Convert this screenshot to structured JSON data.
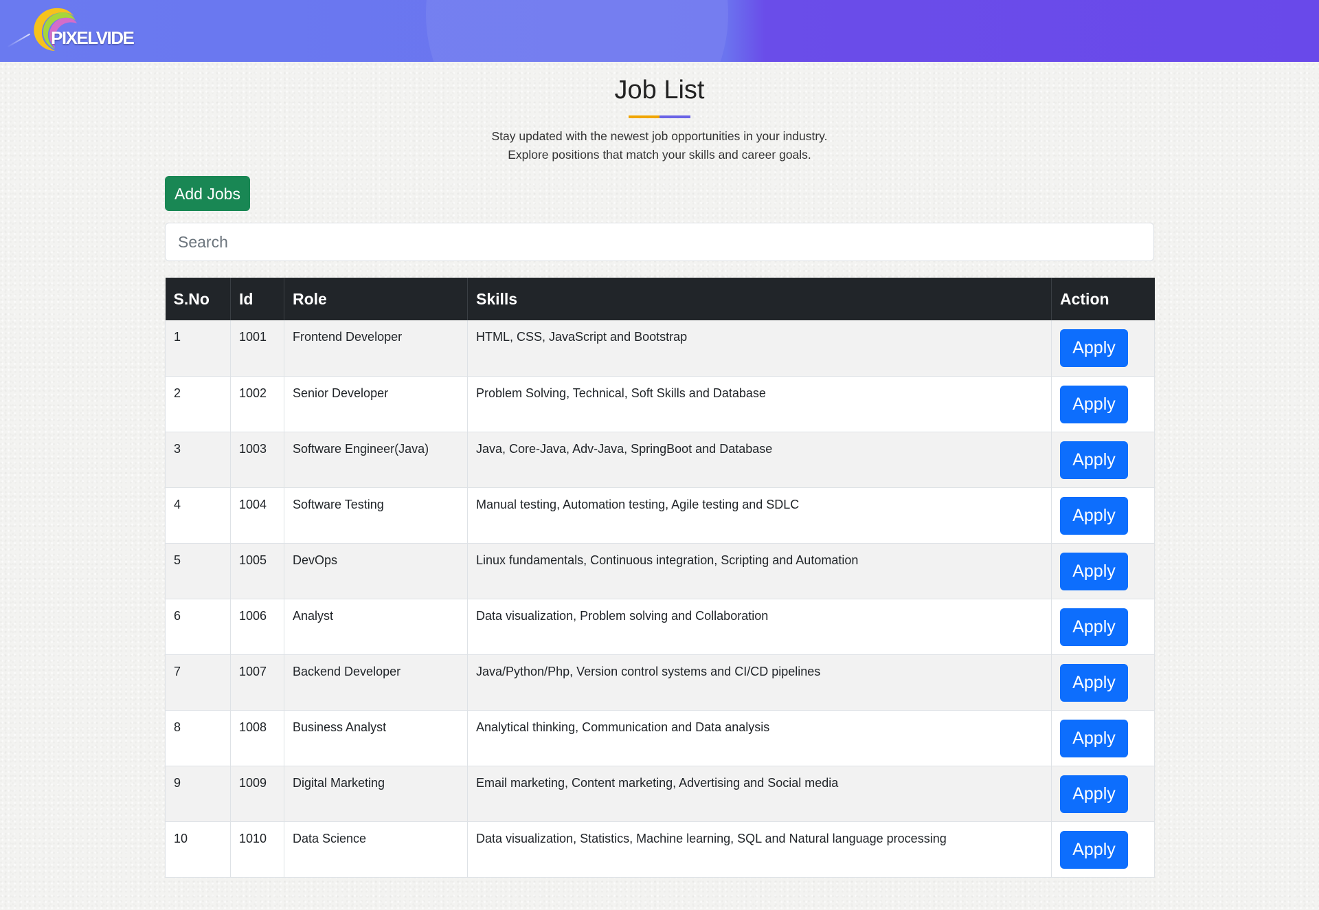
{
  "header": {
    "logo_text": "PIXELVIDE",
    "colors": {
      "gradient_left": "#6a7af0",
      "gradient_right": "#6949ea"
    }
  },
  "page": {
    "title": "Job List",
    "subtitle_line1": "Stay updated with the newest job opportunities in your industry.",
    "subtitle_line2": "Explore positions that match your skills and career goals."
  },
  "toolbar": {
    "add_jobs_label": "Add Jobs",
    "add_jobs_color": "#198754"
  },
  "search": {
    "placeholder": "Search",
    "value": ""
  },
  "table": {
    "headers": [
      "S.No",
      "Id",
      "Role",
      "Skills",
      "Action"
    ],
    "apply_label": "Apply",
    "apply_color": "#0d6efd",
    "rows": [
      {
        "sno": "1",
        "id": "1001",
        "role": "Frontend Developer",
        "skills": "HTML, CSS, JavaScript and Bootstrap"
      },
      {
        "sno": "2",
        "id": "1002",
        "role": "Senior Developer",
        "skills": "Problem Solving, Technical, Soft Skills and Database"
      },
      {
        "sno": "3",
        "id": "1003",
        "role": "Software Engineer(Java)",
        "skills": "Java, Core-Java, Adv-Java, SpringBoot and Database"
      },
      {
        "sno": "4",
        "id": "1004",
        "role": "Software Testing",
        "skills": "Manual testing, Automation testing, Agile testing and SDLC"
      },
      {
        "sno": "5",
        "id": "1005",
        "role": "DevOps",
        "skills": "Linux fundamentals, Continuous integration, Scripting and Automation"
      },
      {
        "sno": "6",
        "id": "1006",
        "role": "Analyst",
        "skills": "Data visualization, Problem solving and Collaboration"
      },
      {
        "sno": "7",
        "id": "1007",
        "role": "Backend Developer",
        "skills": "Java/Python/Php, Version control systems and CI/CD pipelines"
      },
      {
        "sno": "8",
        "id": "1008",
        "role": "Business Analyst",
        "skills": "Analytical thinking, Communication and Data analysis"
      },
      {
        "sno": "9",
        "id": "1009",
        "role": "Digital Marketing",
        "skills": "Email marketing, Content marketing, Advertising and Social media"
      },
      {
        "sno": "10",
        "id": "1010",
        "role": "Data Science",
        "skills": "Data visualization, Statistics, Machine learning, SQL and Natural language processing"
      }
    ]
  }
}
